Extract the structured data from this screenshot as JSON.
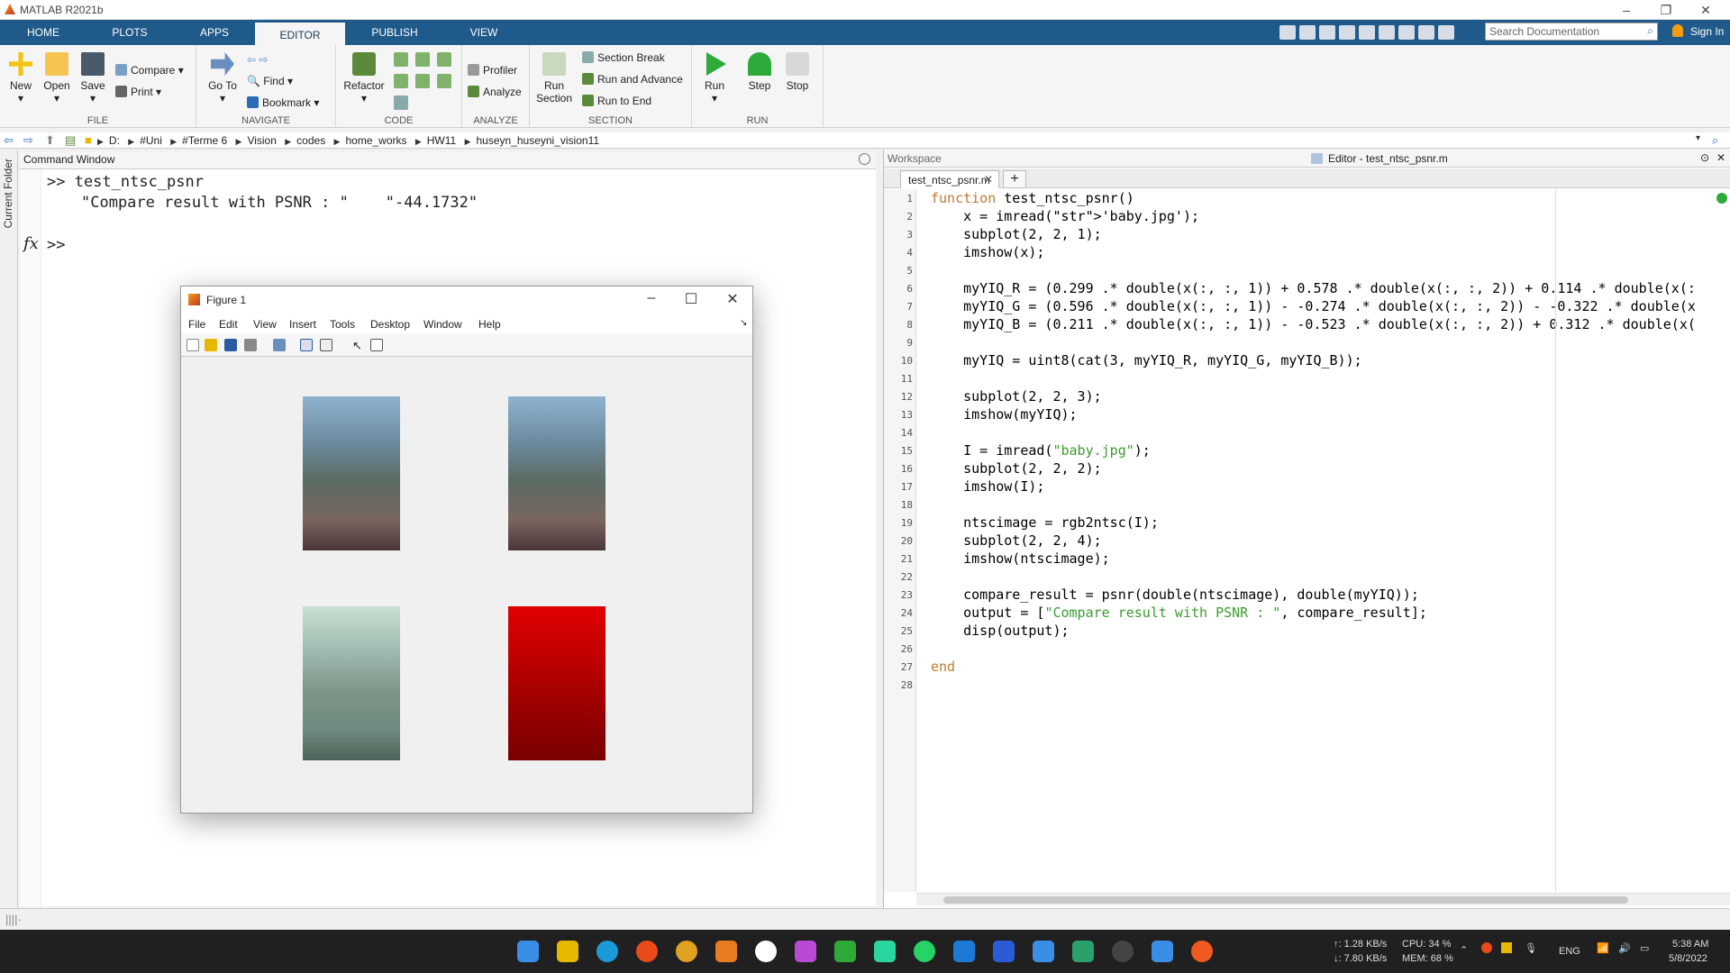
{
  "window": {
    "title": "MATLAB R2021b"
  },
  "tabs": [
    {
      "label": "HOME"
    },
    {
      "label": "PLOTS"
    },
    {
      "label": "APPS"
    },
    {
      "label": "EDITOR"
    },
    {
      "label": "PUBLISH"
    },
    {
      "label": "VIEW"
    }
  ],
  "search": {
    "placeholder": "Search Documentation"
  },
  "signin": "Sign In",
  "ribbon": {
    "file": {
      "label": "FILE",
      "new": "New",
      "open": "Open",
      "save": "Save",
      "compare": "Compare",
      "print": "Print"
    },
    "navigate": {
      "label": "NAVIGATE",
      "goto": "Go To",
      "find": "Find",
      "bookmark": "Bookmark"
    },
    "code": {
      "label": "CODE",
      "refactor": "Refactor"
    },
    "analyze": {
      "label": "ANALYZE",
      "profiler": "Profiler",
      "analyze": "Analyze"
    },
    "section": {
      "label": "SECTION",
      "run_section": "Run Section",
      "section_break": "Section Break",
      "run_and_advance": "Run and Advance",
      "run_to_end": "Run to End"
    },
    "run": {
      "label": "RUN",
      "run": "Run",
      "step": "Step",
      "stop": "Stop"
    }
  },
  "breadcrumb": [
    "D:",
    "#Uni",
    "#Terme 6",
    "Vision",
    "codes",
    "home_works",
    "HW11",
    "huseyn_huseyni_vision11"
  ],
  "left_tab": "Current Folder",
  "command_window": {
    "title": "Command Window",
    "line1": ">> test_ntsc_psnr",
    "line2": "\"Compare result with PSNR : \"    \"-44.1732\"",
    "prompt": ">>",
    "fx": "fx"
  },
  "workspace": {
    "title": "Workspace"
  },
  "editor": {
    "title": "Editor - test_ntsc_psnr.m",
    "tab": "test_ntsc_psnr.m",
    "lines": [
      "function test_ntsc_psnr()",
      "    x = imread('baby.jpg');",
      "    subplot(2, 2, 1);",
      "    imshow(x);",
      "",
      "    myYIQ_R = (0.299 .* double(x(:, :, 1)) + 0.578 .* double(x(:, :, 2)) + 0.114 .* double(x(:",
      "    myYIQ_G = (0.596 .* double(x(:, :, 1)) - -0.274 .* double(x(:, :, 2)) - -0.322 .* double(x",
      "    myYIQ_B = (0.211 .* double(x(:, :, 1)) - -0.523 .* double(x(:, :, 2)) + 0.312 .* double(x(",
      "",
      "    myYIQ = uint8(cat(3, myYIQ_R, myYIQ_G, myYIQ_B));",
      "",
      "    subplot(2, 2, 3);",
      "    imshow(myYIQ);",
      "",
      "    I = imread(\"baby.jpg\");",
      "    subplot(2, 2, 2);",
      "    imshow(I);",
      "",
      "    ntscimage = rgb2ntsc(I);",
      "    subplot(2, 2, 4);",
      "    imshow(ntscimage);",
      "",
      "    compare_result = psnr(double(ntscimage), double(myYIQ));",
      "    output = [\"Compare result with PSNR : \", compare_result];",
      "    disp(output);",
      "",
      "end",
      ""
    ]
  },
  "figure": {
    "title": "Figure 1",
    "menu": [
      "File",
      "Edit",
      "View",
      "Insert",
      "Tools",
      "Desktop",
      "Window",
      "Help"
    ]
  },
  "taskbar": {
    "net_up": "↑: 1.28 KB/s",
    "net_down": "↓: 7.80 KB/s",
    "cpu": "CPU: 34 %",
    "mem": "MEM: 68 %",
    "lang": "ENG",
    "time": "5:38 AM",
    "date": "5/8/2022"
  },
  "colors": {
    "tabbar": "#1f5a8a",
    "keyword": "#c07a30",
    "string": "#3a9d2e"
  }
}
